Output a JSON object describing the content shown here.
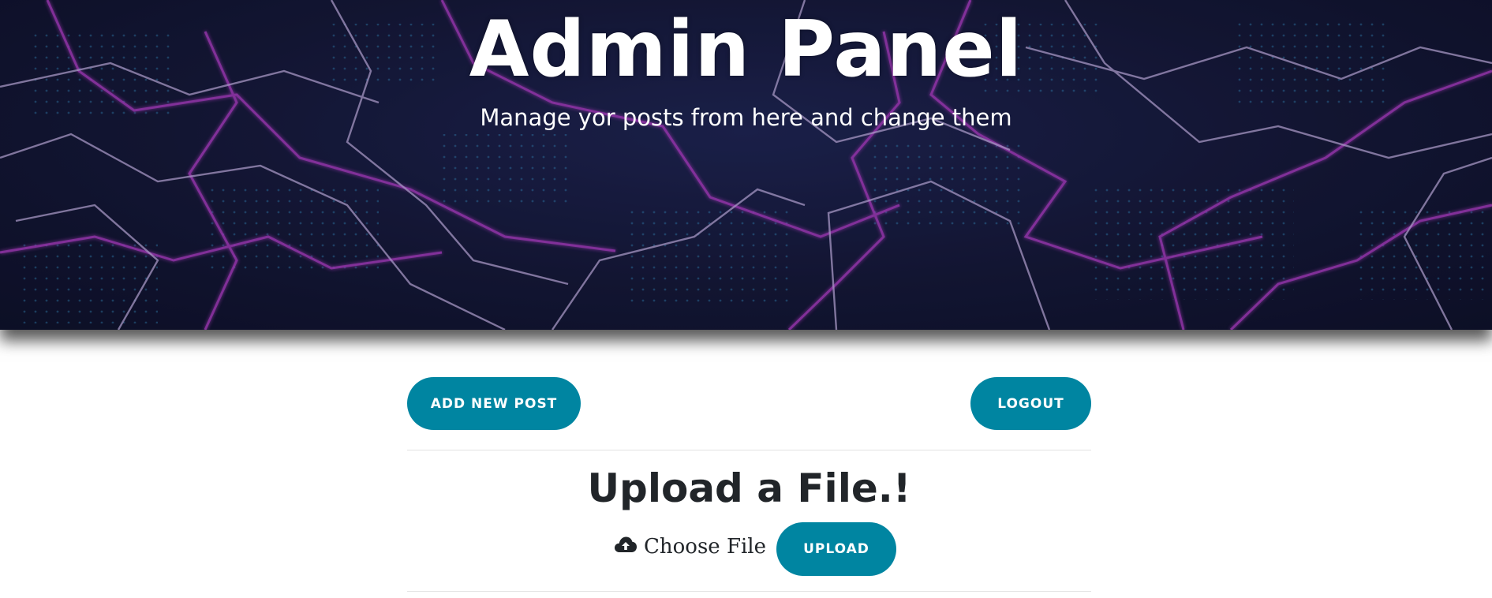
{
  "hero": {
    "title": "Admin Panel",
    "subtitle": "Manage yor posts from here and change them"
  },
  "toolbar": {
    "add_post_label": "ADD NEW POST",
    "logout_label": "LOGOUT"
  },
  "upload": {
    "heading": "Upload a File.!",
    "choose_file_label": "Choose File",
    "upload_button_label": "UPLOAD",
    "choose_file_icon": "cloud-upload-icon"
  },
  "colors": {
    "accent": "#0085a1",
    "text_dark": "#212529",
    "hero_bg": "#141634",
    "line_magenta": "#b43cc8",
    "line_lavender": "#c8b4e6",
    "dot_cyan": "#3a9fd4"
  }
}
